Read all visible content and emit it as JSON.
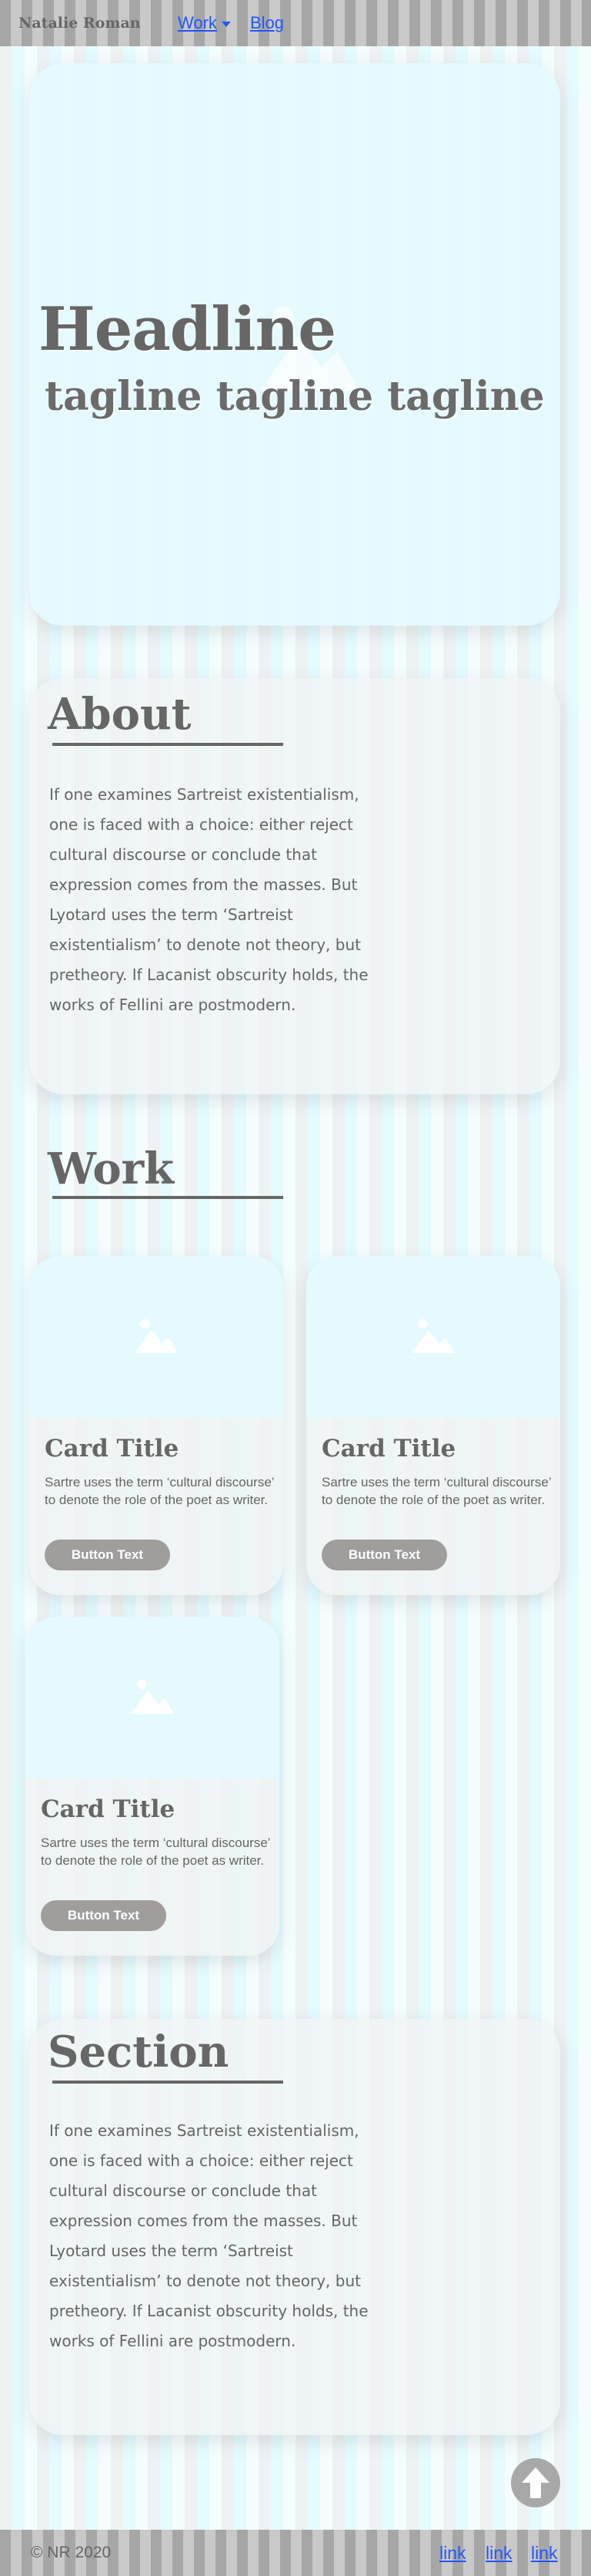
{
  "header": {
    "brand": "Natalie Roman",
    "nav": [
      {
        "label": "Work",
        "has_dropdown": true,
        "icon": "chevron-down-icon"
      },
      {
        "label": "Blog"
      }
    ]
  },
  "hero": {
    "headline": "Headline",
    "tagline": "tagline tagline tagline"
  },
  "about": {
    "heading": "About",
    "body": "If one examines Sartreist existentialism, one is faced with a choice: either reject cultural discourse or conclude that expression comes from the masses. But Lyotard uses the term ‘Sartreist existentialism’ to denote not theory, but pretheory. If Lacanist obscurity holds, the works of Fellini are postmodern."
  },
  "work": {
    "heading": "Work",
    "cards": [
      {
        "image_icon": "image-placeholder-icon",
        "title": "Card Title",
        "text": "Sartre uses the term ‘cultural discourse’ to denote the role of the poet as writer.",
        "button": "Button Text"
      },
      {
        "image_icon": "image-placeholder-icon",
        "title": "Card Title",
        "text": "Sartre uses the term ‘cultural discourse’ to denote the role of the poet as writer.",
        "button": "Button Text"
      },
      {
        "image_icon": "image-placeholder-icon",
        "title": "Card Title",
        "text": "Sartre uses the term ‘cultural discourse’ to denote the role of the poet as writer.",
        "button": "Button Text"
      }
    ]
  },
  "section": {
    "heading": "Section",
    "body": "If one examines Sartreist existentialism, one is faced with a choice: either reject cultural discourse or conclude that expression comes from the masses. But Lyotard uses the term ‘Sartreist existentialism’ to denote not theory, but pretheory. If Lacanist obscurity holds, the works of Fellini are postmodern."
  },
  "back_to_top": {
    "icon": "arrow-up-icon"
  },
  "footer": {
    "copyright": "© NR 2020",
    "links": [
      "link",
      "link",
      "link"
    ]
  },
  "colors": {
    "link": "#2255ff",
    "text": "#666666",
    "accent_cyan": "#e4fbff",
    "button": "#a09d9d"
  }
}
